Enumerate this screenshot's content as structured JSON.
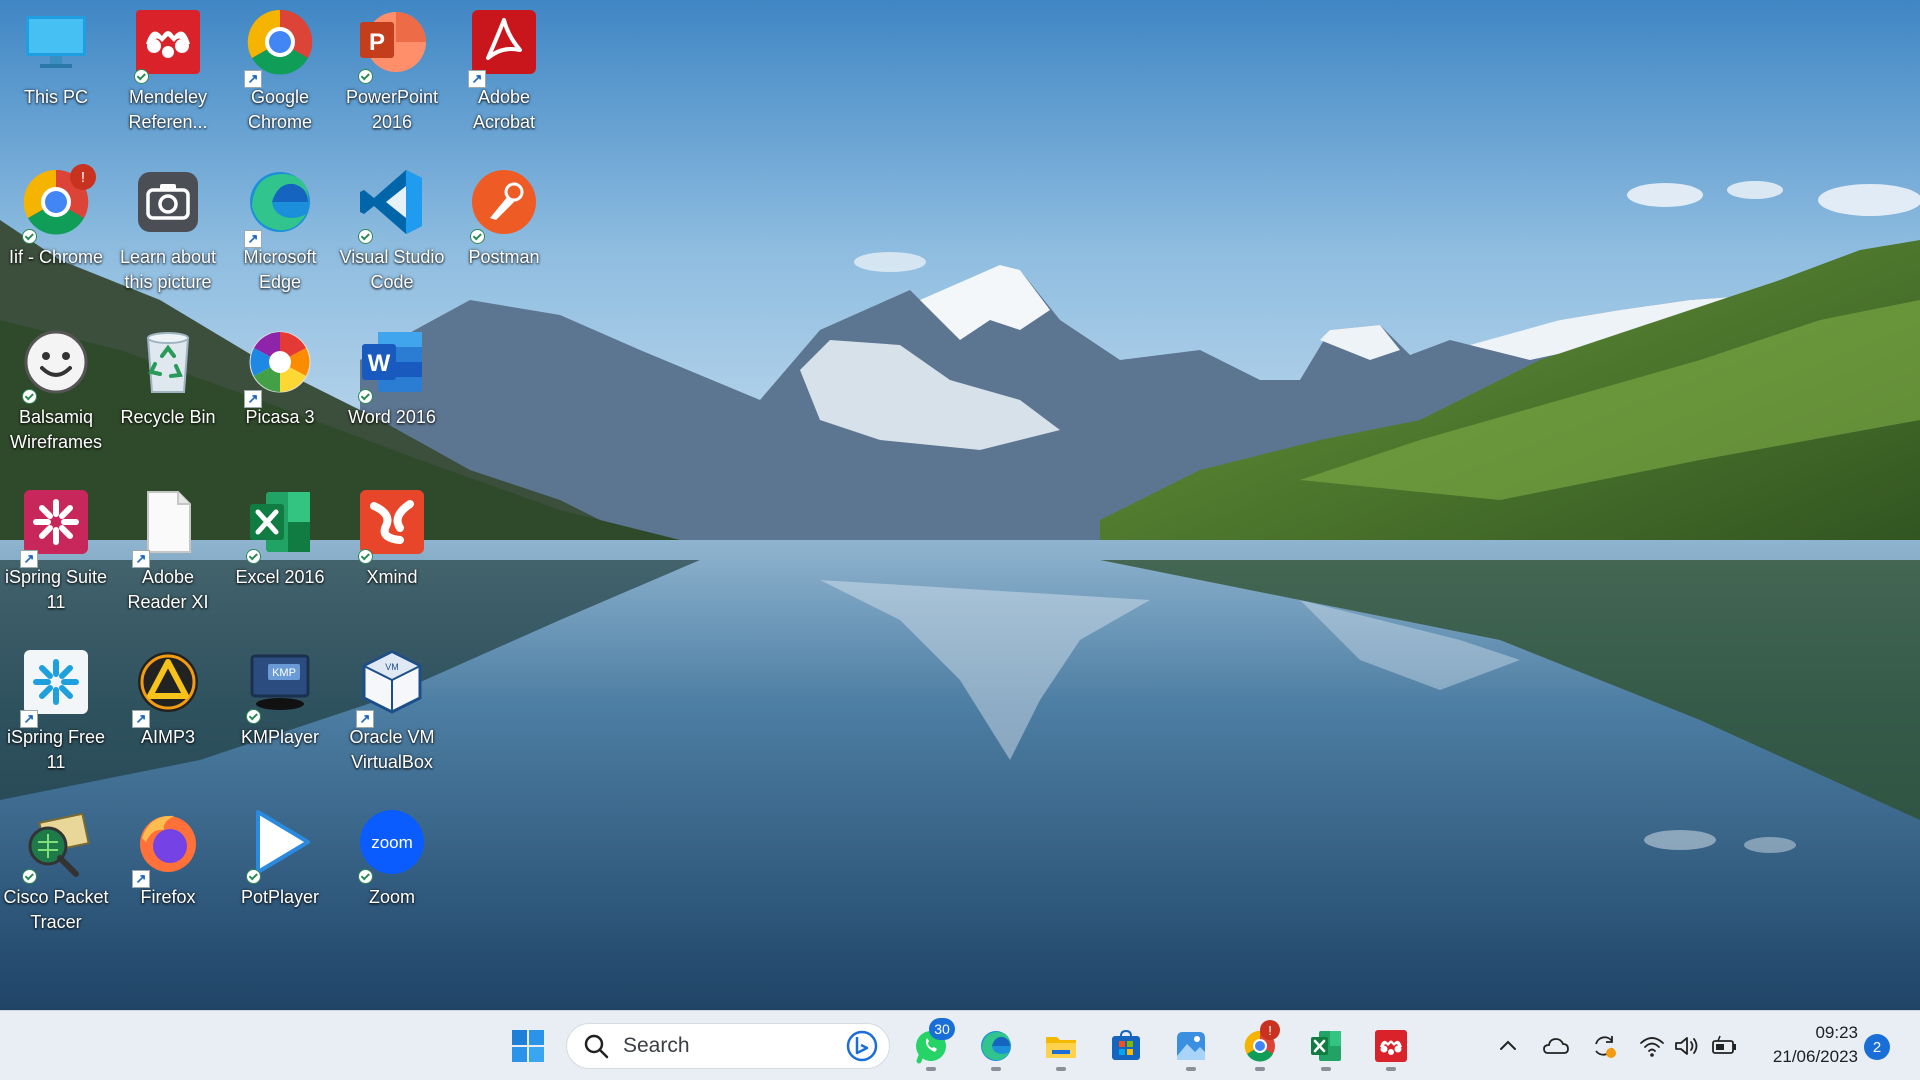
{
  "desktop": {
    "icons": [
      {
        "label": "This PC",
        "icon": "this-pc-icon",
        "badge": "none"
      },
      {
        "label": "Mendeley\nReferen...",
        "icon": "mendeley-icon",
        "badge": "check"
      },
      {
        "label": "Google\nChrome",
        "icon": "chrome-icon",
        "badge": "shortcut"
      },
      {
        "label": "PowerPoint\n2016",
        "icon": "powerpoint-icon",
        "badge": "check"
      },
      {
        "label": "Adobe\nAcrobat",
        "icon": "acrobat-icon",
        "badge": "shortcut"
      },
      {
        "label": "Iif - Chrome",
        "icon": "chrome-icon",
        "badge": "check",
        "alert": "!"
      },
      {
        "label": "Learn about\nthis picture",
        "icon": "camera-icon",
        "badge": "none"
      },
      {
        "label": "Microsoft\nEdge",
        "icon": "edge-icon",
        "badge": "shortcut"
      },
      {
        "label": "Visual Studio\nCode",
        "icon": "vscode-icon",
        "badge": "check"
      },
      {
        "label": "Postman",
        "icon": "postman-icon",
        "badge": "check"
      },
      {
        "label": "Balsamiq\nWireframes",
        "icon": "balsamiq-icon",
        "badge": "check"
      },
      {
        "label": "Recycle Bin",
        "icon": "recycle-bin-icon",
        "badge": "none"
      },
      {
        "label": "Picasa 3",
        "icon": "picasa-icon",
        "badge": "shortcut"
      },
      {
        "label": "Word 2016",
        "icon": "word-icon",
        "badge": "check"
      },
      {
        "label": "iSpring Suite\n11",
        "icon": "ispring-suite-icon",
        "badge": "shortcut"
      },
      {
        "label": "Adobe\nReader XI",
        "icon": "document-icon",
        "badge": "shortcut"
      },
      {
        "label": "Excel 2016",
        "icon": "excel-icon",
        "badge": "check"
      },
      {
        "label": "Xmind",
        "icon": "xmind-icon",
        "badge": "check"
      },
      {
        "label": "iSpring Free\n11",
        "icon": "ispring-free-icon",
        "badge": "shortcut"
      },
      {
        "label": "AIMP3",
        "icon": "aimp-icon",
        "badge": "shortcut"
      },
      {
        "label": "KMPlayer",
        "icon": "kmplayer-icon",
        "badge": "check"
      },
      {
        "label": "Oracle VM\nVirtualBox",
        "icon": "virtualbox-icon",
        "badge": "shortcut"
      },
      {
        "label": "Cisco Packet\nTracer",
        "icon": "packet-tracer-icon",
        "badge": "check"
      },
      {
        "label": "Firefox",
        "icon": "firefox-icon",
        "badge": "shortcut"
      },
      {
        "label": "PotPlayer",
        "icon": "potplayer-icon",
        "badge": "check"
      },
      {
        "label": "Zoom",
        "icon": "zoom-icon",
        "badge": "check"
      }
    ]
  },
  "taskbar": {
    "search_placeholder": "Search",
    "whatsapp_count": "30",
    "chrome_alert": "!",
    "pinned": [
      "start-icon",
      "whatsapp-icon",
      "edge-icon",
      "file-explorer-icon",
      "microsoft-store-icon",
      "photos-icon",
      "chrome-icon",
      "excel-icon",
      "mendeley-icon"
    ],
    "tray": [
      "chevron-up-icon",
      "onedrive-icon",
      "sync-icon",
      "wifi-icon",
      "volume-icon",
      "battery-icon"
    ],
    "time": "09:23",
    "date": "21/06/2023",
    "notification_count": "2"
  },
  "colors": {
    "taskbar_bg": "#e9eef4",
    "accent": "#1a6ed8"
  }
}
